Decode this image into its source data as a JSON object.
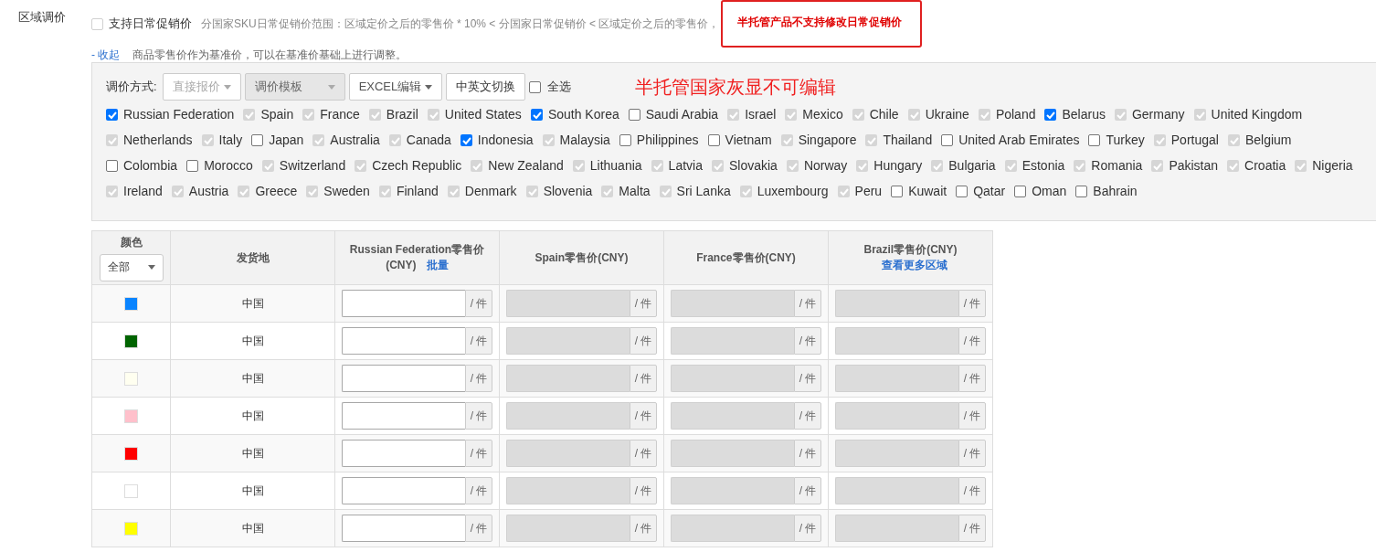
{
  "section_label": "区域调价",
  "daily_promo": {
    "label": "支持日常促销价",
    "checked": false,
    "disabled": true,
    "hint": "分国家SKU日常促销价范围：区域定价之后的零售价 * 10% < 分国家日常促销价 < 区域定价之后的零售价",
    "separator": "，",
    "notice": "半托管产品不支持修改日常促销价"
  },
  "collapse_link": "- 收起",
  "base_note": "商品零售价作为基准价，可以在基准价基础上进行调整。",
  "toolbar": {
    "label": "调价方式:",
    "dropdowns": [
      {
        "label": "直接报价",
        "kind": "menu",
        "disabled": true
      },
      {
        "label": "调价模板",
        "kind": "select",
        "disabled": true
      },
      {
        "label": "EXCEL编辑",
        "kind": "menu",
        "disabled": false
      }
    ],
    "button": "中英文切换",
    "select_all": {
      "label": "全选",
      "checked": false
    },
    "annotation": "半托管国家灰显不可编辑"
  },
  "country_rows": [
    [
      {
        "name": "Russian Federation",
        "checked": true,
        "disabled": false
      },
      {
        "name": "Spain",
        "checked": true,
        "disabled": true
      },
      {
        "name": "France",
        "checked": true,
        "disabled": true
      },
      {
        "name": "Brazil",
        "checked": true,
        "disabled": true
      },
      {
        "name": "United States",
        "checked": true,
        "disabled": true
      },
      {
        "name": "South Korea",
        "checked": true,
        "disabled": false
      },
      {
        "name": "Saudi Arabia",
        "checked": false,
        "disabled": false
      },
      {
        "name": "Israel",
        "checked": true,
        "disabled": true
      },
      {
        "name": "Mexico",
        "checked": true,
        "disabled": true
      },
      {
        "name": "Chile",
        "checked": true,
        "disabled": true
      },
      {
        "name": "Ukraine",
        "checked": true,
        "disabled": true
      },
      {
        "name": "Poland",
        "checked": true,
        "disabled": true
      },
      {
        "name": "Belarus",
        "checked": true,
        "disabled": false
      },
      {
        "name": "Germany",
        "checked": true,
        "disabled": true
      },
      {
        "name": "United Kingdom",
        "checked": true,
        "disabled": true
      }
    ],
    [
      {
        "name": "Netherlands",
        "checked": true,
        "disabled": true
      },
      {
        "name": "Italy",
        "checked": true,
        "disabled": true
      },
      {
        "name": "Japan",
        "checked": false,
        "disabled": false
      },
      {
        "name": "Australia",
        "checked": true,
        "disabled": true
      },
      {
        "name": "Canada",
        "checked": true,
        "disabled": true
      },
      {
        "name": "Indonesia",
        "checked": true,
        "disabled": false
      },
      {
        "name": "Malaysia",
        "checked": true,
        "disabled": true
      },
      {
        "name": "Philippines",
        "checked": false,
        "disabled": false
      },
      {
        "name": "Vietnam",
        "checked": false,
        "disabled": false
      },
      {
        "name": "Singapore",
        "checked": true,
        "disabled": true
      },
      {
        "name": "Thailand",
        "checked": true,
        "disabled": true
      },
      {
        "name": "United Arab Emirates",
        "checked": false,
        "disabled": false
      },
      {
        "name": "Turkey",
        "checked": false,
        "disabled": false
      },
      {
        "name": "Portugal",
        "checked": true,
        "disabled": true
      },
      {
        "name": "Belgium",
        "checked": true,
        "disabled": true
      }
    ],
    [
      {
        "name": "Colombia",
        "checked": false,
        "disabled": false
      },
      {
        "name": "Morocco",
        "checked": false,
        "disabled": false
      },
      {
        "name": "Switzerland",
        "checked": true,
        "disabled": true
      },
      {
        "name": "Czech Republic",
        "checked": true,
        "disabled": true
      },
      {
        "name": "New Zealand",
        "checked": true,
        "disabled": true
      },
      {
        "name": "Lithuania",
        "checked": true,
        "disabled": true
      },
      {
        "name": "Latvia",
        "checked": true,
        "disabled": true
      },
      {
        "name": "Slovakia",
        "checked": true,
        "disabled": true
      },
      {
        "name": "Norway",
        "checked": true,
        "disabled": true
      },
      {
        "name": "Hungary",
        "checked": true,
        "disabled": true
      },
      {
        "name": "Bulgaria",
        "checked": true,
        "disabled": true
      },
      {
        "name": "Estonia",
        "checked": true,
        "disabled": true
      },
      {
        "name": "Romania",
        "checked": true,
        "disabled": true
      },
      {
        "name": "Pakistan",
        "checked": true,
        "disabled": true
      },
      {
        "name": "Croatia",
        "checked": true,
        "disabled": true
      },
      {
        "name": "Nigeria",
        "checked": true,
        "disabled": true
      }
    ],
    [
      {
        "name": "Ireland",
        "checked": true,
        "disabled": true
      },
      {
        "name": "Austria",
        "checked": true,
        "disabled": true
      },
      {
        "name": "Greece",
        "checked": true,
        "disabled": true
      },
      {
        "name": "Sweden",
        "checked": true,
        "disabled": true
      },
      {
        "name": "Finland",
        "checked": true,
        "disabled": true
      },
      {
        "name": "Denmark",
        "checked": true,
        "disabled": true
      },
      {
        "name": "Slovenia",
        "checked": true,
        "disabled": true
      },
      {
        "name": "Malta",
        "checked": true,
        "disabled": true
      },
      {
        "name": "Sri Lanka",
        "checked": true,
        "disabled": true
      },
      {
        "name": "Luxembourg",
        "checked": true,
        "disabled": true
      },
      {
        "name": "Peru",
        "checked": true,
        "disabled": true
      },
      {
        "name": "Kuwait",
        "checked": false,
        "disabled": false
      },
      {
        "name": "Qatar",
        "checked": false,
        "disabled": false
      },
      {
        "name": "Oman",
        "checked": false,
        "disabled": false
      },
      {
        "name": "Bahrain",
        "checked": false,
        "disabled": false
      }
    ]
  ],
  "table": {
    "columns": [
      {
        "title": "颜色",
        "filter": "全部"
      },
      {
        "title": "发货地"
      },
      {
        "title": "Russian Federation零售价(CNY)",
        "link": "批量"
      },
      {
        "title": "Spain零售价(CNY)"
      },
      {
        "title": "France零售价(CNY)"
      },
      {
        "title": "Brazil零售价(CNY)",
        "link": "查看更多区域"
      }
    ],
    "rows": [
      {
        "color": "#0a84ff",
        "origin": "中国",
        "prices": [
          {
            "disabled": false,
            "unit": "/ 件"
          },
          {
            "disabled": true,
            "unit": "/ 件"
          },
          {
            "disabled": true,
            "unit": "/ 件"
          },
          {
            "disabled": true,
            "unit": "/ 件"
          }
        ]
      },
      {
        "color": "#006400",
        "origin": "中国",
        "prices": [
          {
            "disabled": false,
            "unit": "/ 件"
          },
          {
            "disabled": true,
            "unit": "/ 件"
          },
          {
            "disabled": true,
            "unit": "/ 件"
          },
          {
            "disabled": true,
            "unit": "/ 件"
          }
        ]
      },
      {
        "color": "#fffff0",
        "origin": "中国",
        "prices": [
          {
            "disabled": false,
            "unit": "/ 件"
          },
          {
            "disabled": true,
            "unit": "/ 件"
          },
          {
            "disabled": true,
            "unit": "/ 件"
          },
          {
            "disabled": true,
            "unit": "/ 件"
          }
        ]
      },
      {
        "color": "#ffc0cb",
        "origin": "中国",
        "prices": [
          {
            "disabled": false,
            "unit": "/ 件"
          },
          {
            "disabled": true,
            "unit": "/ 件"
          },
          {
            "disabled": true,
            "unit": "/ 件"
          },
          {
            "disabled": true,
            "unit": "/ 件"
          }
        ]
      },
      {
        "color": "#ff0000",
        "origin": "中国",
        "prices": [
          {
            "disabled": false,
            "unit": "/ 件"
          },
          {
            "disabled": true,
            "unit": "/ 件"
          },
          {
            "disabled": true,
            "unit": "/ 件"
          },
          {
            "disabled": true,
            "unit": "/ 件"
          }
        ]
      },
      {
        "color": "#ffffff",
        "origin": "中国",
        "prices": [
          {
            "disabled": false,
            "unit": "/ 件"
          },
          {
            "disabled": true,
            "unit": "/ 件"
          },
          {
            "disabled": true,
            "unit": "/ 件"
          },
          {
            "disabled": true,
            "unit": "/ 件"
          }
        ]
      },
      {
        "color": "#ffff00",
        "origin": "中国",
        "prices": [
          {
            "disabled": false,
            "unit": "/ 件"
          },
          {
            "disabled": true,
            "unit": "/ 件"
          },
          {
            "disabled": true,
            "unit": "/ 件"
          },
          {
            "disabled": true,
            "unit": "/ 件"
          }
        ]
      }
    ]
  }
}
